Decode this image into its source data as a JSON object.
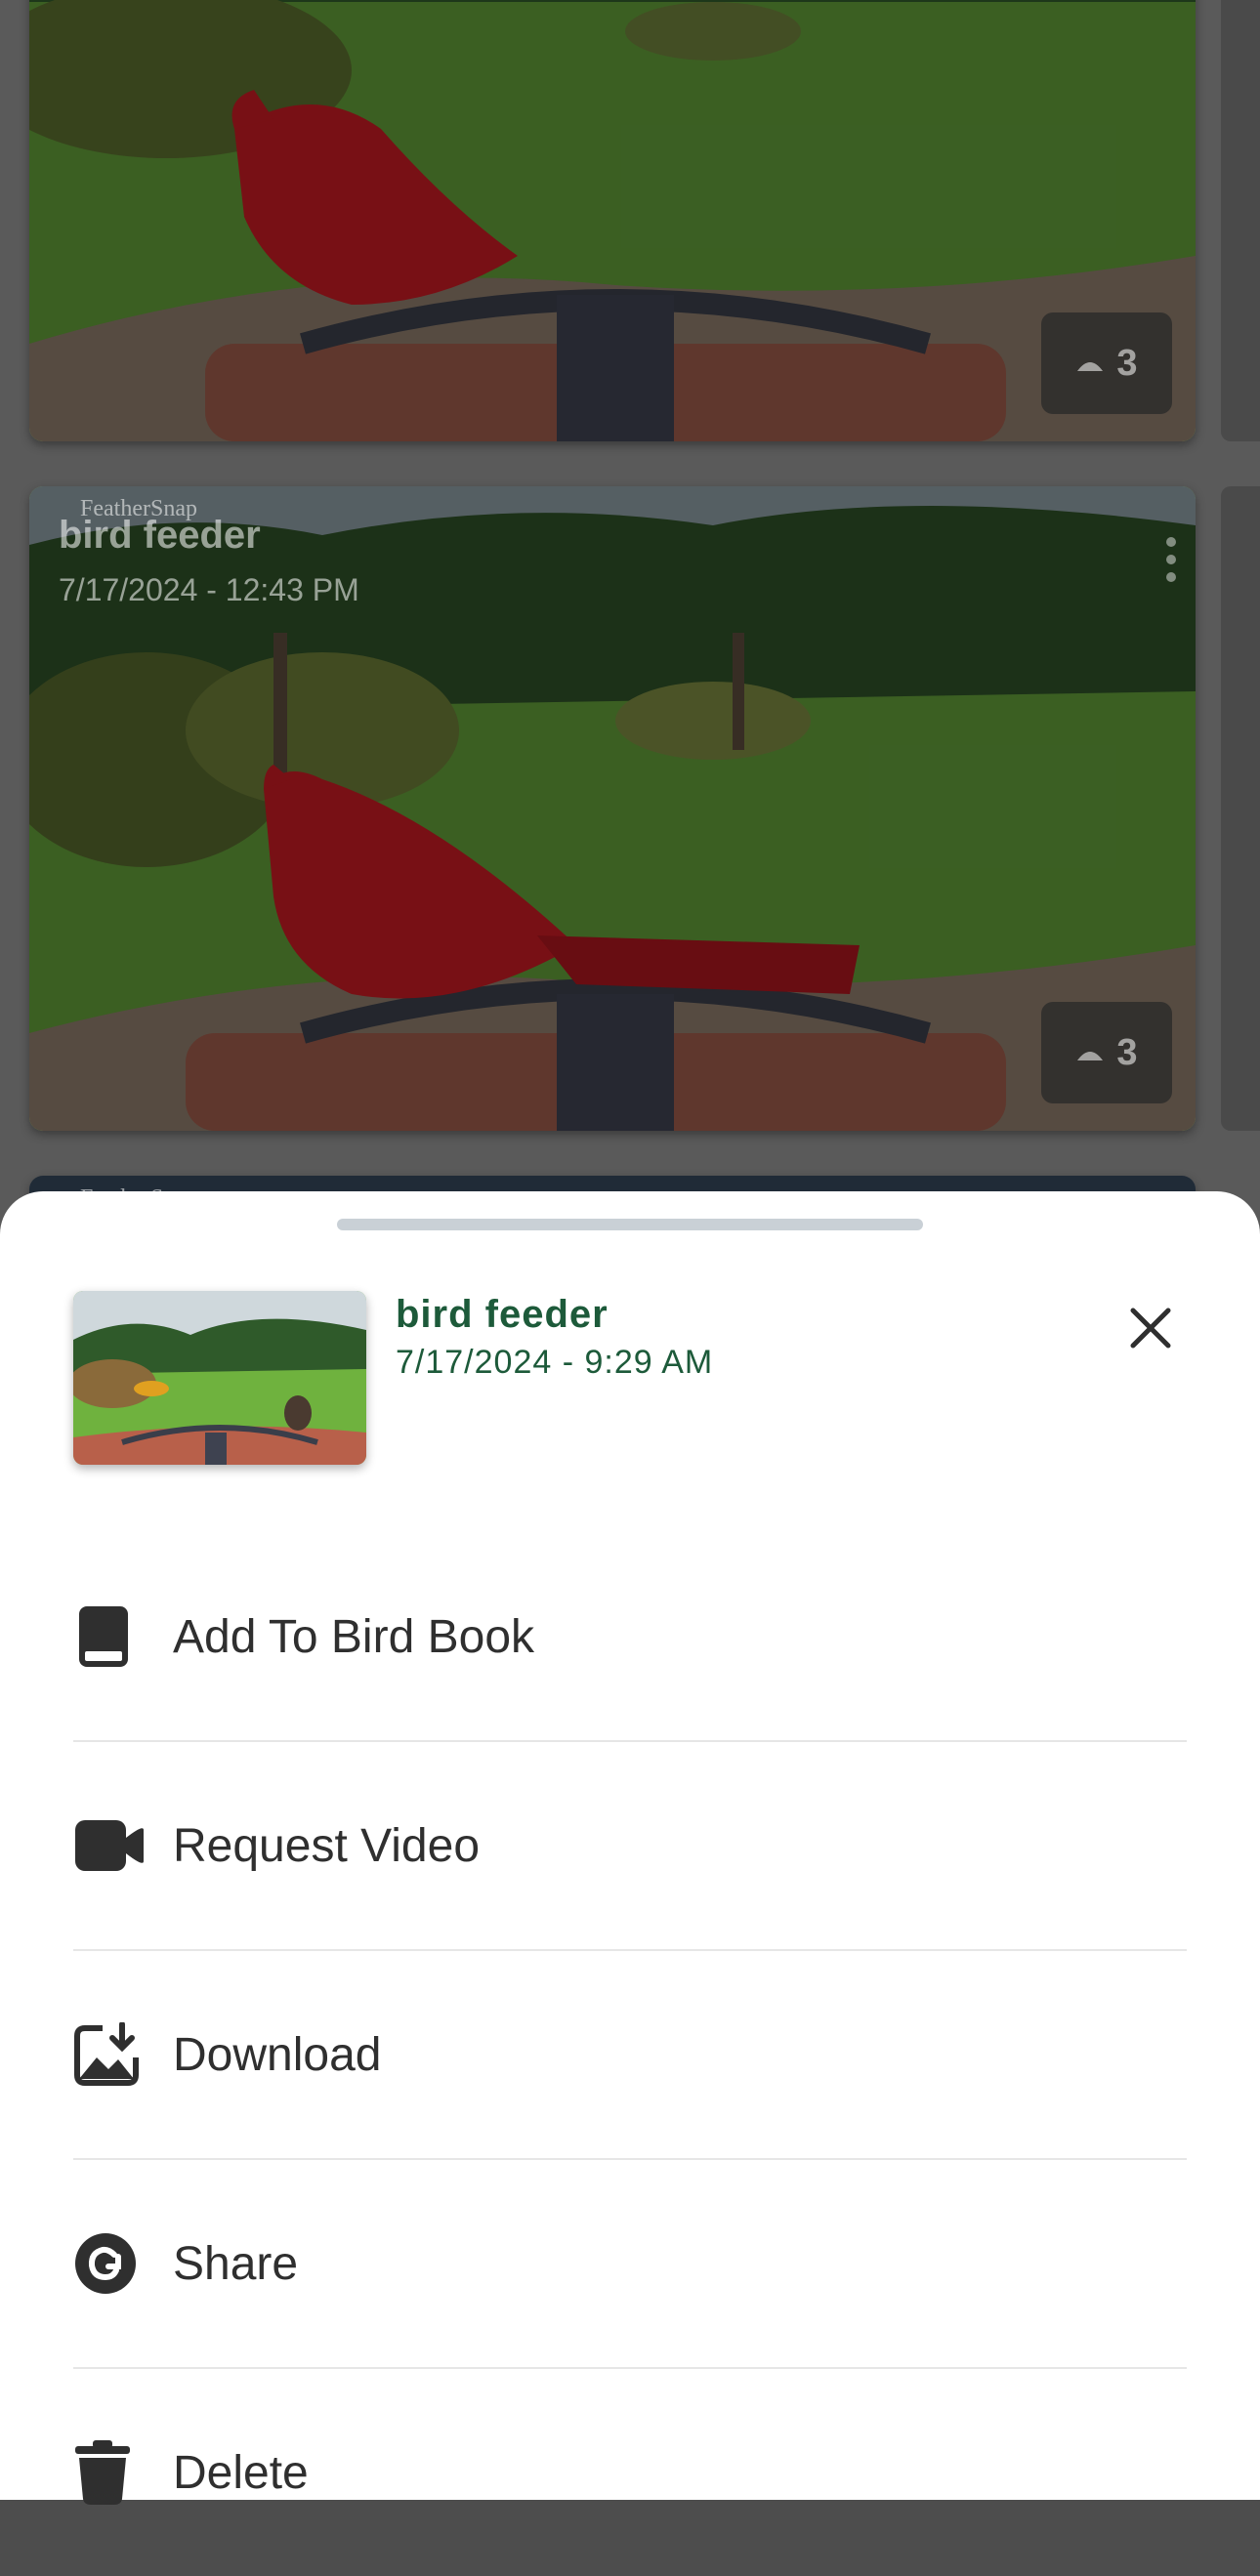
{
  "feed": {
    "cards": [
      {
        "watermark": "",
        "camera": "",
        "timestamp": "",
        "count": "3"
      },
      {
        "watermark": "FeatherSnap",
        "camera": "bird feeder",
        "timestamp": "7/17/2024 - 12:43 PM",
        "count": "3"
      },
      {
        "watermark": "FeatherSnap",
        "camera": "",
        "timestamp": "",
        "count": ""
      }
    ]
  },
  "sheet": {
    "title": "bird feeder",
    "timestamp": "7/17/2024 - 9:29 AM",
    "close_icon": "close-icon",
    "items": [
      {
        "label": "Add To Bird Book",
        "icon": "book-icon"
      },
      {
        "label": "Request Video",
        "icon": "video-camera-icon"
      },
      {
        "label": "Download",
        "icon": "image-download-icon"
      },
      {
        "label": "Share",
        "icon": "share-icon"
      },
      {
        "label": "Delete",
        "icon": "trash-icon"
      }
    ]
  },
  "colors": {
    "accent": "#1d5a3a",
    "cardinal": "#c21a22",
    "lawn": "#5f9a38"
  }
}
